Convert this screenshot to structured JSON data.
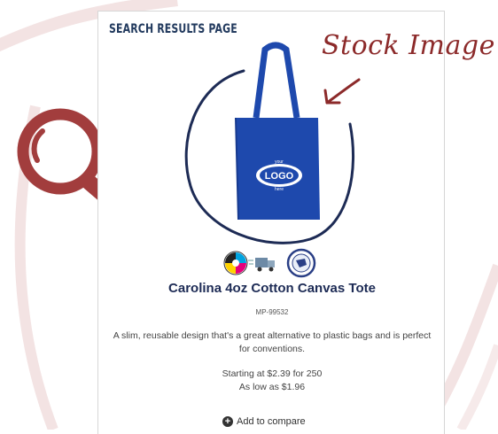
{
  "card": {
    "header": "SEARCH RESULTS PAGE"
  },
  "product": {
    "title": "Carolina 4oz Cotton Canvas Tote",
    "sku": "MP-99532",
    "description": "A slim, reusable design that's a great alternative to plastic bags and is perfect for conventions.",
    "price_line_1": "Starting at $2.39 for 250",
    "price_line_2": "As low as $1.96",
    "compare_label": "Add to compare",
    "image_logo_text": "LOGO",
    "image_logo_top": "your",
    "image_logo_bottom": "here"
  },
  "annotations": {
    "stock_label": "Stock Image"
  },
  "colors": {
    "brand_navy": "#223a5e",
    "annotation_red": "#8c2a2a",
    "tote_blue": "#1e49ad"
  },
  "icons": [
    "full-color-print-icon",
    "shipping-truck-icon",
    "usa-made-seal-icon",
    "magnifying-glass-icon",
    "plus-circle-icon",
    "arrow-icon"
  ]
}
